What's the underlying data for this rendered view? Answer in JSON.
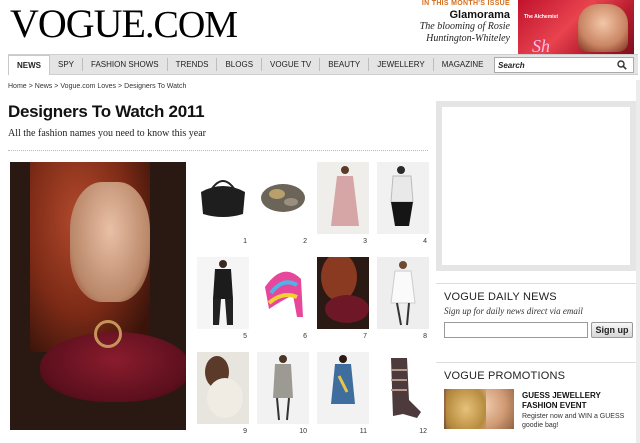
{
  "header": {
    "logo_main": "VOGUE",
    "logo_suffix": ".COM",
    "issue_kicker": "IN THIS MONTH'S ISSUE",
    "issue_title": "Glamorama",
    "issue_desc_1": "The blooming of Rosie",
    "issue_desc_2": "Huntington-Whiteley",
    "cover_name": "The Alchemist",
    "cover_big": "Sh"
  },
  "nav": {
    "items": [
      "NEWS",
      "SPY",
      "FASHION SHOWS",
      "TRENDS",
      "BLOGS",
      "VOGUE TV",
      "BEAUTY",
      "JEWELLERY",
      "MAGAZINE"
    ],
    "search_value": "Search"
  },
  "breadcrumb": [
    "Home",
    "News",
    "Vogue.com Loves",
    "Designers To Watch"
  ],
  "page": {
    "title": "Designers To Watch 2011",
    "subtitle": "All the fashion names you need to know this year"
  },
  "gallery": {
    "numbers": [
      "1",
      "2",
      "3",
      "4",
      "5",
      "6",
      "7",
      "8",
      "9",
      "10",
      "11",
      "12"
    ]
  },
  "newsletter": {
    "title": "VOGUE DAILY NEWS",
    "desc": "Sign up for daily news direct via email",
    "button": "Sign up"
  },
  "promotions": {
    "title": "VOGUE PROMOTIONS",
    "headline_1": "GUESS JEWELLERY",
    "headline_2": "FASHION EVENT",
    "body": "Register now and WIN a GUESS goodie bag!"
  },
  "colors": {
    "accent_orange": "#d56d1d",
    "nav_bg": "#e4e4e4"
  }
}
